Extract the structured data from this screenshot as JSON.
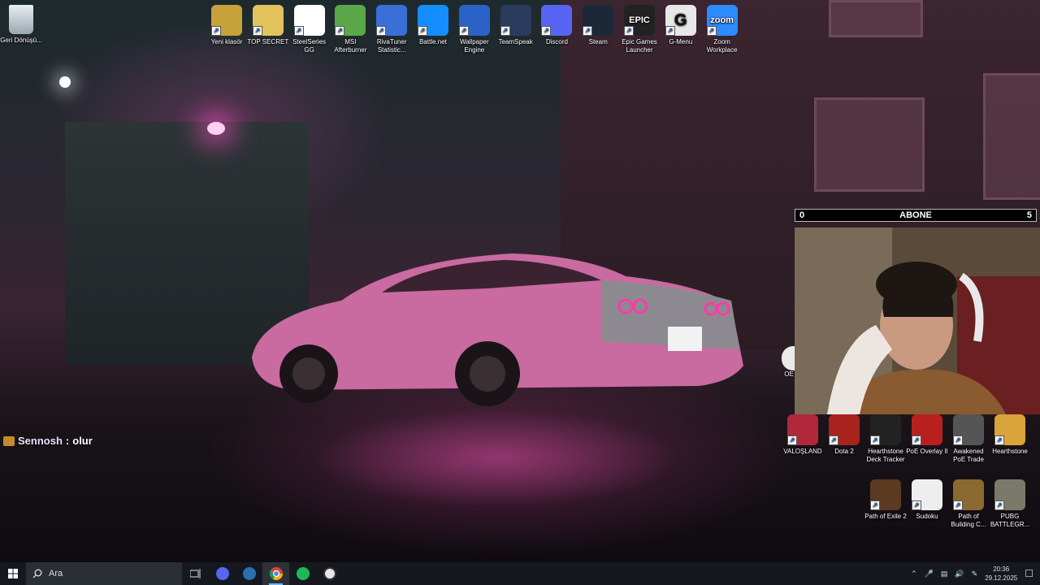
{
  "desktop_left": [
    {
      "label": "Geri Dönüşü...",
      "icon": "recycle-bin-icon"
    }
  ],
  "top_icons": [
    {
      "label": "Yeni klasör",
      "icon": "winrar-folder-icon",
      "color": "#c7a23a"
    },
    {
      "label": "TOP SECRET",
      "icon": "folder-icon",
      "color": "#e2c25a"
    },
    {
      "label": "SteelSeries GG",
      "icon": "steelseries-icon",
      "color": "#ffffff"
    },
    {
      "label": "MSI Afterburner",
      "icon": "msi-afterburner-icon",
      "color": "#5aa84a"
    },
    {
      "label": "RivaTuner Statistic...",
      "icon": "rivatuner-icon",
      "color": "#3a6fd8"
    },
    {
      "label": "Battle.net",
      "icon": "battlenet-icon",
      "color": "#148eff"
    },
    {
      "label": "Wallpaper Engine",
      "icon": "wallpaper-engine-icon",
      "color": "#2a62c8"
    },
    {
      "label": "TeamSpeak",
      "icon": "teamspeak-icon",
      "color": "#2a3b5e"
    },
    {
      "label": "Discord",
      "icon": "discord-icon",
      "color": "#5865f2"
    },
    {
      "label": "Steam",
      "icon": "steam-icon",
      "color": "#1b2838"
    },
    {
      "label": "Epic Games Launcher",
      "icon": "epic-games-icon",
      "color": "#222222",
      "glyph": "EPIC"
    },
    {
      "label": "G-Menu",
      "icon": "g-menu-icon",
      "color": "#e8e8e8",
      "glyph": "G"
    },
    {
      "label": "Zoom Workplace",
      "icon": "zoom-icon",
      "color": "#2d8cff",
      "glyph": "zoom"
    }
  ],
  "right_row1": [
    {
      "label": "VALOŞLAND",
      "icon": "valorant-icon",
      "color": "#b0283a"
    },
    {
      "label": "Dota 2",
      "icon": "dota2-icon",
      "color": "#a8231d"
    },
    {
      "label": "Hearthstone Deck Tracker",
      "icon": "hdt-icon",
      "color": "#222222"
    },
    {
      "label": "PoE Overlay II",
      "icon": "poe-overlay-icon",
      "color": "#b82020"
    },
    {
      "label": "Awakened PoE Trade",
      "icon": "awakened-poe-icon",
      "color": "#555555"
    },
    {
      "label": "Hearthstone",
      "icon": "hearthstone-icon",
      "color": "#d9a43a"
    }
  ],
  "right_row2": [
    {
      "label": "Path of Exile 2",
      "icon": "poe2-icon",
      "color": "#5a3a20"
    },
    {
      "label": "Sudoku",
      "icon": "sudoku-icon",
      "color": "#eeeeee"
    },
    {
      "label": "Path of Building C...",
      "icon": "pob-icon",
      "color": "#8a6a30"
    },
    {
      "label": "PUBG BATTLEGR...",
      "icon": "pubg-icon",
      "color": "#7a7a6a"
    }
  ],
  "partial_icon_label": "OE",
  "overlay": {
    "left": "0",
    "title": "ABONE",
    "right": "5"
  },
  "chat": {
    "user": "Sennosh",
    "sep": ":",
    "message": "olur"
  },
  "taskbar": {
    "search_placeholder": "Ara",
    "apps": [
      "task-view-icon",
      "discord-icon",
      "steam-icon",
      "chrome-icon",
      "spotify-icon",
      "obs-icon"
    ],
    "active_app": "chrome-icon",
    "time": "20:36",
    "date": "29.12.2025"
  }
}
